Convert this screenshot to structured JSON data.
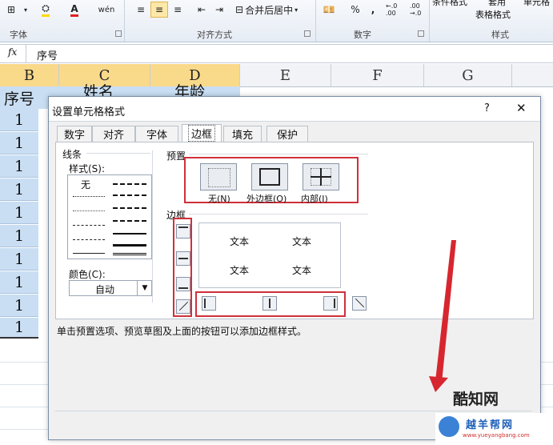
{
  "ribbon": {
    "groups": {
      "font": "字体",
      "align": "对齐方式",
      "number": "数字",
      "styles": "样式"
    },
    "merge": "合并后居中",
    "percent": "%",
    "comma": ",",
    "inc_dec": "←.0 .00",
    "dec_dec": ".00 →.0",
    "cond_format": "条件格式",
    "table_format": "表格格式",
    "table_top": "套用",
    "cell_style": "单元格"
  },
  "formula_bar": {
    "fx": "fx",
    "value": "序号"
  },
  "columns": [
    "B",
    "C",
    "D",
    "E",
    "F",
    "G"
  ],
  "header_cells": {
    "b": "序号",
    "c": "姓名",
    "d": "年龄"
  },
  "col_b_values": [
    "1",
    "1",
    "1",
    "1",
    "1",
    "1",
    "1",
    "1",
    "1",
    "1"
  ],
  "dialog": {
    "title": "设置单元格格式",
    "help": "?",
    "close": "✕",
    "tabs": [
      "数字",
      "对齐",
      "字体",
      "边框",
      "填充",
      "保护"
    ],
    "active_tab": "边框",
    "line_group": "线条",
    "style_label": "样式(S):",
    "none_style": "无",
    "color_label": "颜色(C):",
    "color_value": "自动",
    "presets_label": "预置",
    "preset_none": "无(N)",
    "preset_outline": "外边框(O)",
    "preset_inside": "内部(I)",
    "border_label": "边框",
    "preview_text": "文本",
    "hint": "单击预置选项、预览草图及上面的按钮可以添加边框样式。"
  },
  "watermarks": {
    "site1": "酷知网",
    "site2": "越羊帮网",
    "url": "www.yueyangbang.com"
  }
}
